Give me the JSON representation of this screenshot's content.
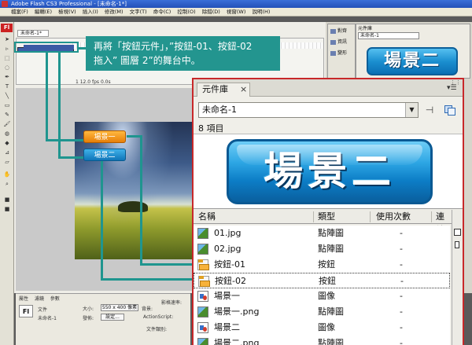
{
  "window": {
    "title": "Adobe Flash CS3 Professional - [未命名-1*]",
    "menus": [
      "檔案(F)",
      "編輯(E)",
      "檢視(V)",
      "插入(I)",
      "修改(M)",
      "文字(T)",
      "命令(C)",
      "控制(O)",
      "除錯(D)",
      "視窗(W)",
      "說明(H)"
    ]
  },
  "tools": {
    "badge": "Fl"
  },
  "document": {
    "tab": "未命名-1*",
    "timeline_status": "1   12.0 fps   0.0s"
  },
  "annotation": {
    "line1": "再將「按鈕元件」，”按鈕-01、按鈕-02",
    "line2": "拖入” 圖層 2”的舞台中。"
  },
  "stage_buttons": {
    "btn01": "場景一",
    "btn02": "場景二"
  },
  "properties": {
    "tabs": [
      "屬性",
      "濾鏡",
      "參數"
    ],
    "kind": "文件",
    "doc_name": "未命名-1",
    "size_label": "大小:",
    "size_value": "550 x 400 像素",
    "publish_label": "發佈:",
    "settings_button": "設定...",
    "bg_label": "背景:",
    "fps_label": "影格速率:",
    "actionscript_label": "ActionScript:",
    "class_label": "文件類別:"
  },
  "side_panel": {
    "items": [
      "對齊",
      "資訊",
      "變形"
    ],
    "mini_library_tab": "元件庫",
    "mini_library_select": "未命名-1",
    "mini_preview": "場景二"
  },
  "library": {
    "tab_label": "元件庫",
    "close_glyph": "×",
    "document_select": "未命名-1",
    "item_count": "8 項目",
    "preview_label": "場景二",
    "columns": [
      "名稱",
      "類型",
      "使用次數",
      "連結"
    ],
    "rows": [
      {
        "name": "01.jpg",
        "type": "點陣圖",
        "uses": "-",
        "icon": "bitmap-icon",
        "selected": false
      },
      {
        "name": "02.jpg",
        "type": "點陣圖",
        "uses": "-",
        "icon": "bitmap-icon",
        "selected": false
      },
      {
        "name": "按鈕-01",
        "type": "按鈕",
        "uses": "-",
        "icon": "button-symbol-icon",
        "selected": false
      },
      {
        "name": "按鈕-02",
        "type": "按鈕",
        "uses": "-",
        "icon": "button-symbol-icon",
        "selected": true
      },
      {
        "name": "場景一",
        "type": "圖像",
        "uses": "-",
        "icon": "graphic-symbol-icon",
        "selected": false
      },
      {
        "name": "場景一.png",
        "type": "點陣圖",
        "uses": "-",
        "icon": "bitmap-icon",
        "selected": false
      },
      {
        "name": "場景二",
        "type": "圖像",
        "uses": "-",
        "icon": "graphic-symbol-icon",
        "selected": false
      },
      {
        "name": "場景二.png",
        "type": "點陣圖",
        "uses": "-",
        "icon": "bitmap-icon",
        "selected": false
      }
    ]
  },
  "colors": {
    "annotation": "#23958f",
    "library_border": "#c8282a",
    "button_blue": "#1b8fd0",
    "button_orange": "#e77f08"
  }
}
